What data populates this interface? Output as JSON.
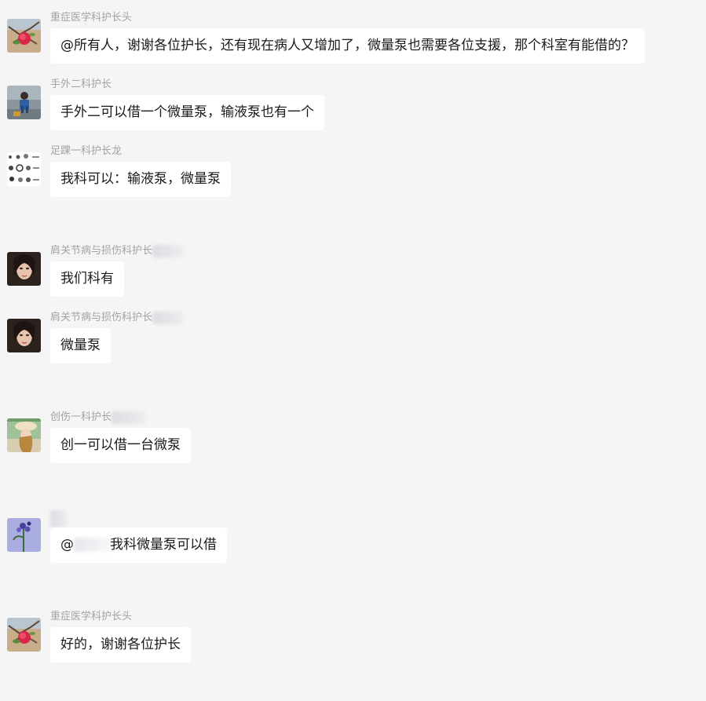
{
  "messages": [
    {
      "sender": "重症医学科护长头",
      "text": "@所有人，谢谢各位护长，还有现在病人又增加了，微量泵也需要各位支援，那个科室有能借的？",
      "avatar_icon": "red-flower-avatar"
    },
    {
      "sender": "手外二科护长",
      "text": "手外二可以借一个微量泵，输液泵也有一个",
      "avatar_icon": "child-photo-avatar"
    },
    {
      "sender": "足踝一科护长龙",
      "text": "我科可以：输液泵，微量泵",
      "avatar_icon": "emoji-grid-avatar"
    },
    {
      "sender": "肩关节病与损伤科护长",
      "text": "我们科有",
      "avatar_icon": "woman-portrait-avatar"
    },
    {
      "sender": "肩关节病与损伤科护长",
      "text": "微量泵",
      "avatar_icon": "woman-portrait-avatar"
    },
    {
      "sender": "创伤一科护长",
      "text": "创一可以借一台微泵",
      "avatar_icon": "girl-hat-avatar"
    },
    {
      "sender": "",
      "mention_prefix": "@",
      "text": "我科微量泵可以借",
      "avatar_icon": "purple-flower-avatar"
    },
    {
      "sender": "重症医学科护长头",
      "text": "好的，谢谢各位护长",
      "avatar_icon": "red-flower-avatar"
    }
  ],
  "colors": {
    "background": "#f5f5f5",
    "bubble": "#ffffff",
    "sender_text": "#a3a3a3",
    "message_text": "#1a1a1a"
  }
}
